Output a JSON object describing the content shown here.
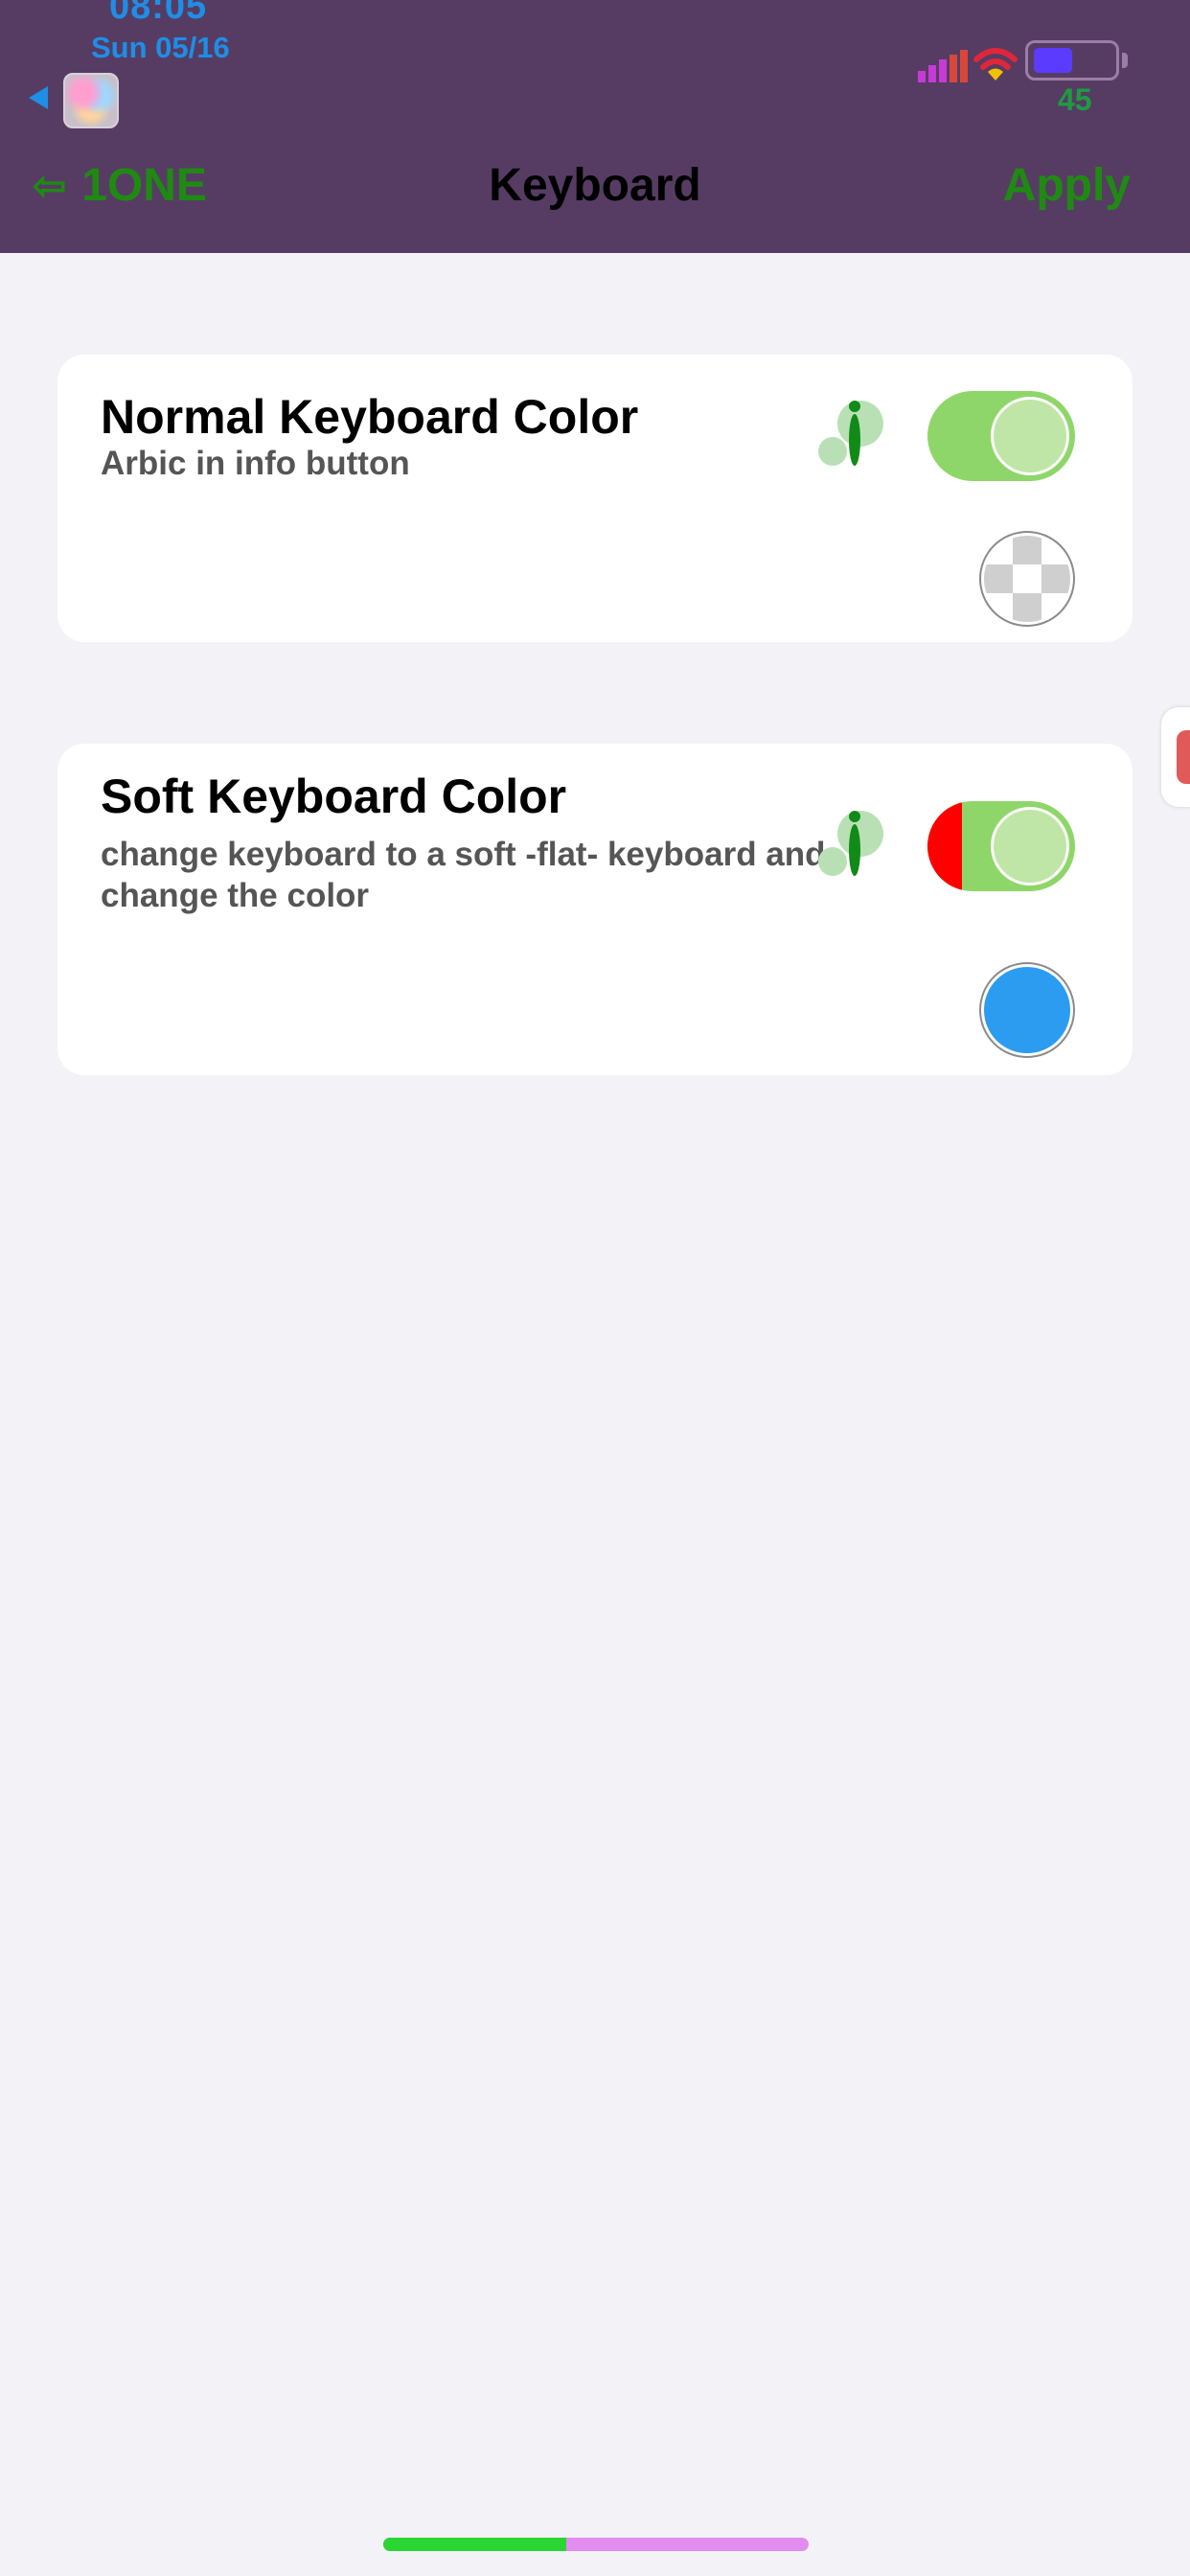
{
  "status_bar": {
    "time": "08:05",
    "date": "Sun 05/16",
    "battery_level": "45",
    "colors": {
      "time": "#1e8ee6",
      "battery_fill": "#5b3cff",
      "battery_text": "#1f9a43"
    }
  },
  "nav": {
    "back_label": "1ONE",
    "title": "Keyboard",
    "apply_label": "Apply",
    "accent_color": "#1f8a12",
    "background_color": "#563c63"
  },
  "settings": [
    {
      "title": "Normal Keyboard Color",
      "subtitle": "Arbic in info button",
      "toggle_on": true,
      "swatch": "transparent"
    },
    {
      "title": "Soft Keyboard Color",
      "subtitle_line1": "change keyboard to a soft -flat- keyboard and",
      "subtitle_line2": "change the color",
      "toggle_on": true,
      "swatch": "#2c9cf0"
    }
  ],
  "home_indicator": {
    "progress": 0.43
  }
}
